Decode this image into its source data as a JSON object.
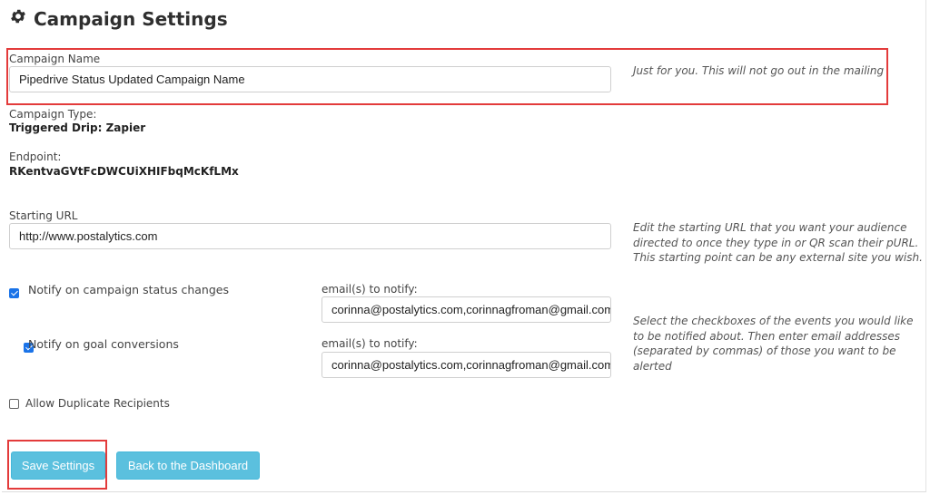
{
  "page": {
    "title": "Campaign Settings",
    "title_icon": "gear-icon"
  },
  "campaign_name": {
    "label": "Campaign Name",
    "value": "Pipedrive Status Updated Campaign Name",
    "hint": "Just for you. This will not go out in the mailing"
  },
  "campaign_type": {
    "label": "Campaign Type:",
    "value": "Triggered Drip: Zapier"
  },
  "endpoint": {
    "label": "Endpoint:",
    "value": "RKentvaGVtFcDWCUiXHIFbqMcKfLMx"
  },
  "starting_url": {
    "label": "Starting URL",
    "value": "http://www.postalytics.com",
    "hint": "Edit the starting URL that you want your audience directed to once they type in or QR scan their pURL. This starting point can be any external site you wish."
  },
  "notifications": {
    "status_changes": {
      "label": "Notify on campaign status changes",
      "checked": true,
      "email_label": "email(s) to notify:",
      "email_value": "corinna@postalytics.com,corinnagfroman@gmail.com"
    },
    "goal_conversions": {
      "label": "Notify on goal conversions",
      "checked": true,
      "email_label": "email(s) to notify:",
      "email_value": "corinna@postalytics.com,corinnagfroman@gmail.com"
    },
    "hint": "Select the checkboxes of the events you would like to be notified about. Then enter email addresses (separated by commas) of those you want to be alerted"
  },
  "duplicates": {
    "label": "Allow Duplicate Recipients",
    "checked": false
  },
  "buttons": {
    "save": "Save Settings",
    "back": "Back to the Dashboard"
  },
  "colors": {
    "button": "#5bc0de",
    "highlight": "#e33b3b",
    "checkbox": "#1a73e8"
  }
}
